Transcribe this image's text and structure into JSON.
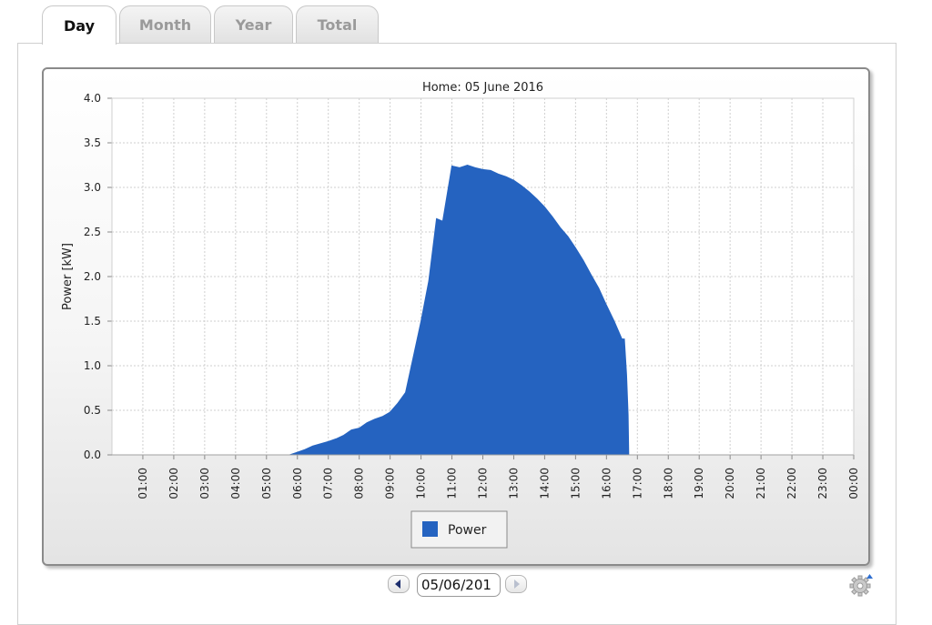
{
  "tabs": [
    {
      "label": "Day",
      "active": true
    },
    {
      "label": "Month",
      "active": false
    },
    {
      "label": "Year",
      "active": false
    },
    {
      "label": "Total",
      "active": false
    }
  ],
  "chart_data": {
    "type": "area",
    "title": "Home: 05 June 2016",
    "xlabel": "",
    "ylabel": "Power [kW]",
    "ylim": [
      0,
      4
    ],
    "yticks": [
      "0.0",
      "0.5",
      "1.0",
      "1.5",
      "2.0",
      "2.5",
      "3.0",
      "3.5",
      "4.0"
    ],
    "xticks": [
      "01:00",
      "02:00",
      "03:00",
      "04:00",
      "05:00",
      "06:00",
      "07:00",
      "08:00",
      "09:00",
      "10:00",
      "11:00",
      "12:00",
      "13:00",
      "14:00",
      "15:00",
      "16:00",
      "17:00",
      "18:00",
      "19:00",
      "20:00",
      "21:00",
      "22:00",
      "23:00",
      "00:00"
    ],
    "xlim": [
      0,
      24
    ],
    "grid": true,
    "legend": "bottom-center",
    "series": [
      {
        "name": "Power",
        "color": "#2563c0",
        "points": [
          [
            0.0,
            0
          ],
          [
            5.75,
            0
          ],
          [
            6.0,
            0.03
          ],
          [
            6.25,
            0.06
          ],
          [
            6.5,
            0.1
          ],
          [
            7.0,
            0.15
          ],
          [
            7.25,
            0.18
          ],
          [
            7.5,
            0.22
          ],
          [
            7.75,
            0.28
          ],
          [
            8.0,
            0.3
          ],
          [
            8.25,
            0.36
          ],
          [
            8.5,
            0.4
          ],
          [
            8.75,
            0.43
          ],
          [
            9.0,
            0.48
          ],
          [
            9.25,
            0.58
          ],
          [
            9.5,
            0.7
          ],
          [
            9.75,
            1.1
          ],
          [
            10.0,
            1.5
          ],
          [
            10.25,
            1.95
          ],
          [
            10.5,
            2.65
          ],
          [
            10.7,
            2.62
          ],
          [
            11.0,
            3.24
          ],
          [
            11.25,
            3.22
          ],
          [
            11.5,
            3.25
          ],
          [
            11.75,
            3.22
          ],
          [
            12.0,
            3.2
          ],
          [
            12.25,
            3.19
          ],
          [
            12.5,
            3.15
          ],
          [
            12.75,
            3.12
          ],
          [
            13.0,
            3.08
          ],
          [
            13.25,
            3.02
          ],
          [
            13.5,
            2.95
          ],
          [
            13.75,
            2.87
          ],
          [
            14.0,
            2.78
          ],
          [
            14.25,
            2.67
          ],
          [
            14.5,
            2.55
          ],
          [
            14.75,
            2.45
          ],
          [
            15.0,
            2.32
          ],
          [
            15.25,
            2.18
          ],
          [
            15.5,
            2.02
          ],
          [
            15.75,
            1.87
          ],
          [
            16.0,
            1.68
          ],
          [
            16.25,
            1.5
          ],
          [
            16.5,
            1.3
          ],
          [
            16.58,
            1.3
          ],
          [
            16.65,
            0.9
          ],
          [
            16.7,
            0.45
          ],
          [
            16.72,
            0
          ],
          [
            24.0,
            0
          ]
        ]
      }
    ]
  },
  "controls": {
    "date_value": "05/06/201"
  }
}
